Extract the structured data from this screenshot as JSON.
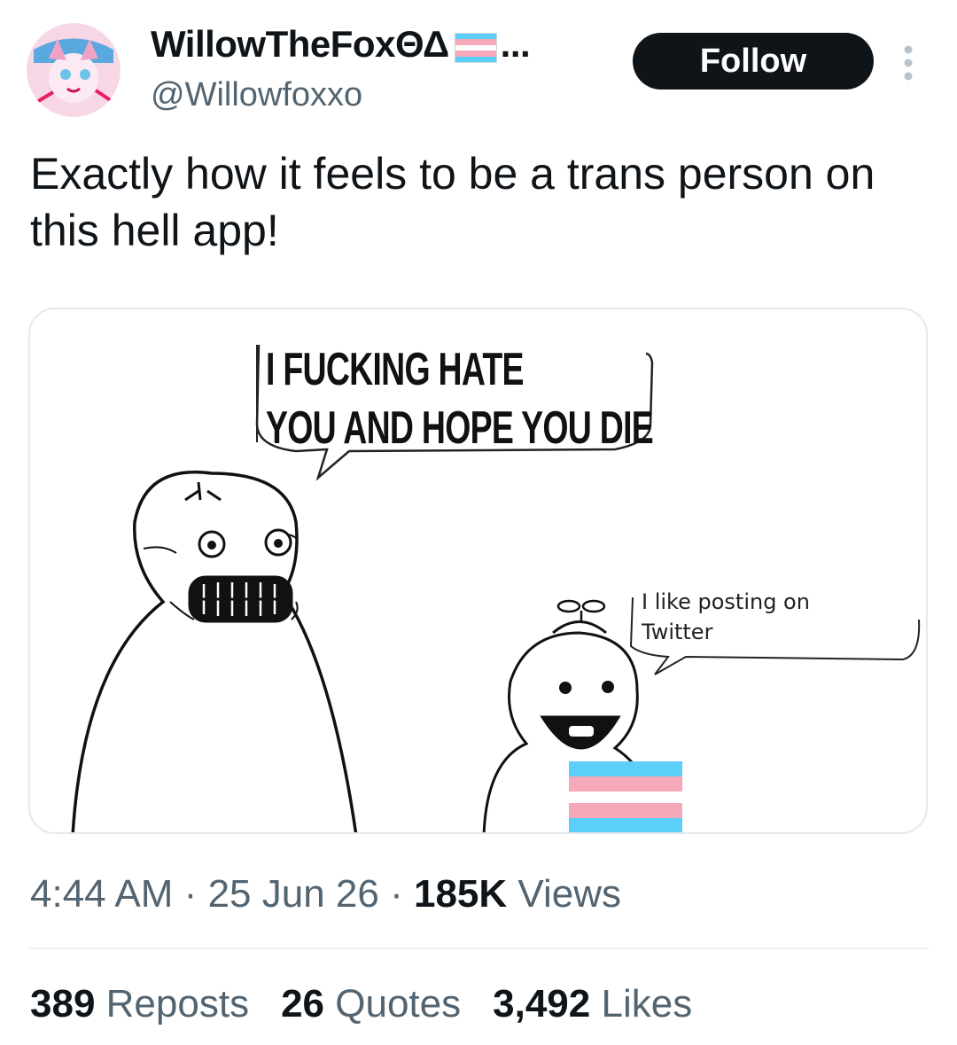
{
  "author": {
    "display_name": "WillowTheFoxΘΔ",
    "display_name_ellipsis": "...",
    "handle": "@Willowfoxxo",
    "avatar_icon": "fox-avatar-icon",
    "flag_icon": "transgender-flag-icon"
  },
  "actions": {
    "follow_label": "Follow",
    "more_icon": "more-vertical-icon"
  },
  "tweet": {
    "text": "Exactly how it feels to be a trans person on this hell app!"
  },
  "media": {
    "speech_big_line1": "I FUCKING HATE",
    "speech_big_line2": "YOU AND HOPE YOU DIE",
    "speech_small_line1": "I like posting on",
    "speech_small_line2": "Twitter"
  },
  "meta": {
    "time": "4:44 AM",
    "date": "25 Jun 26",
    "views_count": "185K",
    "views_label": "Views",
    "separator": "·"
  },
  "stats": {
    "reposts_count": "389",
    "reposts_label": "Reposts",
    "quotes_count": "26",
    "quotes_label": "Quotes",
    "likes_count": "3,492",
    "likes_label": "Likes"
  },
  "colors": {
    "trans_blue": "#5bcefa",
    "trans_pink": "#f5a9b8",
    "secondary_text": "#536471",
    "primary_text": "#0f1419"
  }
}
